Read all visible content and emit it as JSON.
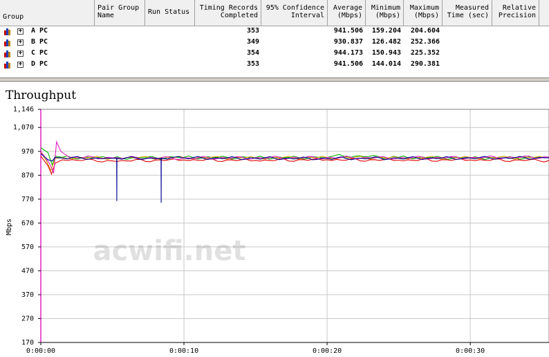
{
  "table": {
    "columns": [
      {
        "label": "Group"
      },
      {
        "label": "Pair Group\nName"
      },
      {
        "label": "Run Status"
      },
      {
        "label": "Timing Records\nCompleted"
      },
      {
        "label": "95% Confidence\nInterval"
      },
      {
        "label": "Average\n(Mbps)"
      },
      {
        "label": "Minimum\n(Mbps)"
      },
      {
        "label": "Maximum\n(Mbps)"
      },
      {
        "label": "Measured\nTime (sec)"
      },
      {
        "label": "Relative\nPrecision"
      }
    ],
    "rows": [
      {
        "name": "A PC",
        "records": "353",
        "average": "941.506",
        "minimum": "159.204",
        "maximum": "204.604"
      },
      {
        "name": "B PC",
        "records": "349",
        "average": "930.837",
        "minimum": "126.482",
        "maximum": "252.366"
      },
      {
        "name": "C PC",
        "records": "354",
        "average": "944.173",
        "minimum": "150.943",
        "maximum": "225.352"
      },
      {
        "name": "D PC",
        "records": "353",
        "average": "941.506",
        "minimum": "144.014",
        "maximum": "290.381"
      }
    ]
  },
  "watermark": "acwifi.net",
  "chart_data": {
    "type": "line",
    "title": "Throughput",
    "ylabel": "Mbps",
    "xlabel": "",
    "y_ticks": [
      "1,146",
      "1,070",
      "970",
      "870",
      "770",
      "670",
      "570",
      "470",
      "370",
      "270",
      "170"
    ],
    "x_ticks": [
      "0:00:00",
      "0:00:10",
      "0:00:20",
      "0:00:30"
    ],
    "ylim": [
      170,
      1146
    ],
    "xlim": [
      0,
      35.5
    ],
    "grid": true,
    "series": [
      {
        "color": "#00b000",
        "x": [
          0,
          0.5,
          0.8,
          1.0,
          1.5,
          5,
          10,
          15,
          20,
          20.5,
          25,
          30,
          35.5
        ],
        "y": [
          985,
          965,
          912,
          950,
          945,
          942,
          945,
          944,
          944,
          952,
          945,
          942,
          944
        ]
      },
      {
        "color": "#d4a000",
        "x": [
          0,
          0.4,
          0.7,
          1.0,
          1.5,
          5,
          10,
          15,
          20,
          25,
          30,
          35.5
        ],
        "y": [
          965,
          930,
          890,
          940,
          944,
          943,
          944,
          943,
          944,
          943,
          944,
          944
        ]
      },
      {
        "color": "#e00000",
        "x": [
          0,
          0.5,
          0.75,
          1.0,
          1.5,
          5,
          10,
          15,
          20,
          25,
          30,
          35.5
        ],
        "y": [
          950,
          910,
          875,
          920,
          935,
          930,
          934,
          932,
          935,
          933,
          934,
          932
        ]
      },
      {
        "color": "#e020c0",
        "x": [
          0,
          0.6,
          0.9,
          1.1,
          1.4,
          2,
          5,
          10,
          15,
          20,
          25,
          30,
          35.5
        ],
        "y": [
          970,
          920,
          880,
          1010,
          970,
          945,
          943,
          942,
          943,
          944,
          943,
          944,
          946
        ]
      },
      {
        "color": "#000090",
        "x": [
          0,
          0.5,
          0.8,
          1.0,
          1.5,
          5,
          5.3,
          5.31,
          5.32,
          8.4,
          8.41,
          8.42,
          10,
          15,
          20,
          25,
          30,
          35.5
        ],
        "y": [
          960,
          935,
          930,
          945,
          942,
          941,
          941,
          762,
          941,
          941,
          755,
          941,
          942,
          941,
          940,
          941,
          942,
          943
        ]
      }
    ]
  }
}
